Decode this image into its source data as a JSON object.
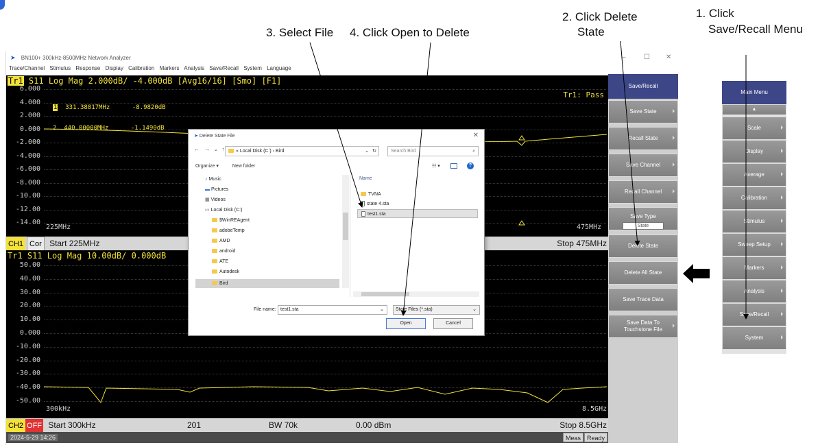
{
  "annotations": {
    "step1_line1": "1. Click",
    "step1_line2": "Save/Recall Menu",
    "step2_line1": "2. Click Delete",
    "step2_line2": "State",
    "step3": "3. Select File",
    "step4": "4. Click Open to Delete"
  },
  "window": {
    "title": "BN100+ 300kHz-8500MHz Network Analyzer",
    "controls": {
      "minimize": "–",
      "maximize": "☐",
      "close": "✕"
    },
    "menu": [
      "Trace/Channel",
      "Stimulus",
      "Response",
      "Display",
      "Calibration",
      "Markers",
      "Analysis",
      "Save/Recall",
      "System",
      "Language"
    ]
  },
  "trace1": {
    "tag": "Tr1",
    "header": "S11 Log Mag 2.000dB/ -4.000dB [Avg16/16] [Smo]  [F1]",
    "y_ticks": [
      "6.000",
      "4.000",
      "2.000",
      "0.000",
      "-2.000",
      "-4.000",
      "-6.000",
      "-8.000",
      "-10.00",
      "-12.00",
      "-14.00"
    ],
    "x_start": "225MHz",
    "x_stop": "475MHz",
    "pass_label": "Tr1: Pass",
    "markers": [
      {
        "num": "1",
        "freq": "331.38817MHz",
        "value": "-8.9820dB"
      },
      {
        "num": "2",
        "freq": "440.00000MHz",
        "value": "-1.1490dB"
      }
    ]
  },
  "ch1_bar": {
    "ch": "CH1",
    "cor": "Cor",
    "start": "Start 225MHz",
    "stop": "Stop 475MHz"
  },
  "trace2": {
    "header": "Tr1 S11 Log Mag 10.00dB/ 0.000dB",
    "y_ticks": [
      "50.00",
      "40.00",
      "30.00",
      "20.00",
      "10.00",
      "0.000",
      "-10.00",
      "-20.00",
      "-30.00",
      "-40.00",
      "-50.00"
    ],
    "x_start": "300kHz",
    "x_stop": "8.5GHz"
  },
  "ch2_bar": {
    "ch": "CH2",
    "off": "OFF",
    "start": "Start 300kHz",
    "points": "201",
    "bw": "BW 70k",
    "power": "0.00 dBm",
    "stop": "Stop 8.5GHz"
  },
  "status": {
    "datetime": "2024-5-29 14:26",
    "meas": "Meas",
    "ready": "Ready"
  },
  "save_recall_panel": {
    "header": "Save/Recall",
    "keys": [
      "Save State",
      "Recall State",
      "Save Channel",
      "Recall Channel",
      "Save Type",
      "Delete State",
      "Delete All State",
      "Save Trace Data",
      "Save Data To Touchstone File"
    ],
    "save_type_value": "State"
  },
  "main_menu_panel": {
    "header": "Main Menu",
    "up_arrow": "▲",
    "keys": [
      "Scale",
      "Display",
      "Average",
      "Calibration",
      "Stimulus",
      "Sweep Setup",
      "Markers",
      "Analysis",
      "Save/Recall",
      "System"
    ]
  },
  "dialog": {
    "title": "Delete State File",
    "path_prefix": "«",
    "path_drive": "Local Disk (C:)",
    "path_sep": "›",
    "path_folder": "Bird",
    "search_placeholder": "Search Bird",
    "organize": "Organize ▾",
    "new_folder": "New folder",
    "tree": [
      "Music",
      "Pictures",
      "Videos",
      "Local Disk (C:)",
      "$WinREAgent",
      "adobeTemp",
      "AMD",
      "android",
      "ATE",
      "Autodesk",
      "Bird"
    ],
    "column_name": "Name",
    "files": [
      "TVNA",
      "state 4.sta",
      "test1.sta"
    ],
    "file_name_label": "File name:",
    "file_name_value": "test1.sta",
    "filter": "State Files (*.sta)",
    "open_button": "Open",
    "cancel_button": "Cancel"
  },
  "colors": {
    "trace": "#f2e23a",
    "softkey_header": "#3d4788",
    "softkey": "#8c8c8c",
    "off_tag": "#e23232"
  }
}
